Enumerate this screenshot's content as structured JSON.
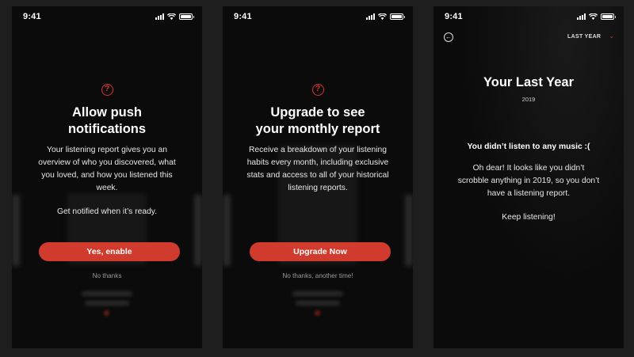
{
  "status_bar": {
    "time": "9:41"
  },
  "screens": {
    "push": {
      "title_line1": "Allow push",
      "title_line2": "notifications",
      "body_lines": [
        "Your listening report gives you an",
        "overview of who you discovered, what",
        "you loved, and how you listened this",
        "week."
      ],
      "note": "Get notified when it’s ready.",
      "primary_button": "Yes, enable",
      "secondary_link": "No thanks"
    },
    "upgrade": {
      "title_line1": "Upgrade to see",
      "title_line2": "your monthly report",
      "body_lines": [
        "Receive a breakdown of your listening",
        "habits every month, including exclusive",
        "stats and access to all of your historical",
        "listening reports."
      ],
      "primary_button": "Upgrade Now",
      "secondary_link": "No thanks, another time!"
    },
    "last_year": {
      "period_selector": "LAST YEAR",
      "title": "Your Last Year",
      "year": "2019",
      "empty_heading": "You didn’t listen to any music :(",
      "empty_body_lines": [
        "Oh dear! It looks like you didn’t",
        "scrobble anything in 2019, so you don’t",
        "have a listening report."
      ],
      "cta_text": "Keep listening!"
    }
  },
  "colors": {
    "accent": "#d13b2e",
    "background": "#0b0b0b",
    "muted_text": "#9a9a9a"
  },
  "icons": {
    "help": "question-circle-icon",
    "back": "back-arrow-circle-icon",
    "dropdown": "chevron-down-icon",
    "signal": "cellular-signal-icon",
    "wifi": "wifi-icon",
    "battery": "battery-icon"
  }
}
